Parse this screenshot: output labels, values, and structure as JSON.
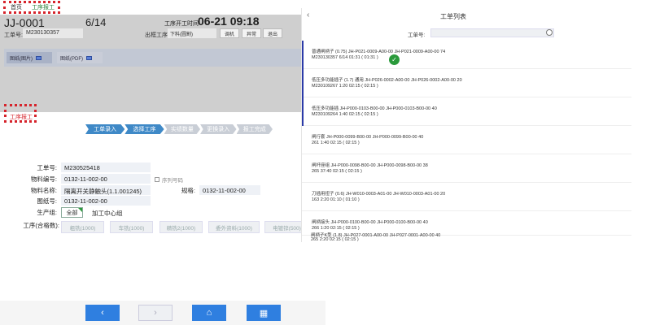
{
  "topnav": {
    "home": "首页",
    "current": "工序报工"
  },
  "header": {
    "job_code": "JJ-0001",
    "progress": "6/14",
    "start_label": "工序开工时间",
    "start_time": "06-21 09:18",
    "order_label": "工单号:",
    "order_value": "M230130357",
    "exit_label": "出框工序:",
    "exit_select": "下料(圆割)",
    "buttons": {
      "adjust": "调机",
      "abnormal": "异常",
      "exit": "退出"
    },
    "tabs": {
      "image": "图纸(图片)",
      "pdf": "图纸(PDF)"
    }
  },
  "report_fab": "工序报工",
  "steps": [
    "工单录入",
    "选择工序",
    "实绩数量",
    "更换录入",
    "报工完成"
  ],
  "form": {
    "order_label": "工单号:",
    "order_value": "M230525418",
    "mat_label": "物料编号:",
    "mat_value": "0132-11-002-00",
    "seq_label": "序列号码",
    "matname_label": "物料名称:",
    "matname_value": "隔离开关静触头(1.1.001245)",
    "spec_label": "规格:",
    "spec_value": "0132-11-002-00",
    "drawing_label": "图纸号:",
    "drawing_value": "0132-11-002-00",
    "group_label": "生产组:",
    "group_all": "全部",
    "group_cnc": "加工中心组",
    "proc_label": "工序(合格数):",
    "procs": [
      "粗铣(1000)",
      "车铣(1000)",
      "精铣2(1000)",
      "委外资料(1000)",
      "电镀锌(500)"
    ]
  },
  "bottom": {
    "back": "‹",
    "next": "›",
    "home": "⌂",
    "keyboard": "▦"
  },
  "right": {
    "back": "‹",
    "title": "工单列表",
    "search_label": "工单号:",
    "rows": [
      {
        "line1": "普通闸柄子 (0.75)  JH-P021-0009-A00-00 JH-P021-0009-A00-00  74",
        "line2": "M230130357  6/14    01:31  ( 01:31 )",
        "selected": true
      },
      {
        "line1": "低压多功能插子 (1.7)  通用  JH-P026-0002-A00-00 JH-P026-0002-A00-00  20",
        "line2": "M230109267  1:20    02:15  ( 02:15 )",
        "selected": true
      },
      {
        "line1": "低压多功能插 JH-P000-0103-B00-00 JH-P000-0103-B00-00  40",
        "line2": "M230109264  1:40    02:15  ( 02:15 )",
        "selected": true
      },
      {
        "line1": "闸行套 JH-P000-0099-B00-00 JH-P000-0099-B00-00  40",
        "line2": "261  1:40    02:15  ( 02:15 )",
        "selected": false
      },
      {
        "line1": "闸杆座组 JH-P000-0098-B00-00 JH-P000-0098-B00-00  38",
        "line2": "265  37:40    02:15  ( 02:15 )",
        "selected": false
      },
      {
        "line1": "刀插用扭子 (0.6)  JH-W010-0003-A01-00 JH-W010-0003-A01-00  20",
        "line2": "163  2:20    01:10  ( 01:10 )",
        "selected": false
      },
      {
        "line1": "闸柄接头 JH-P000-0100-B00-00 JH-P000-0100-B00-00  40",
        "line2": "266  1:20    02:15  ( 02:15 )",
        "selected": false
      },
      {
        "line1": "闸柄子K型 (1.8)  JH-P027-0001-A00-00 JH-P027-0001-A00-00  40",
        "line2": "265  2:20    02:15  ( 02:15 )",
        "selected": false
      }
    ]
  }
}
